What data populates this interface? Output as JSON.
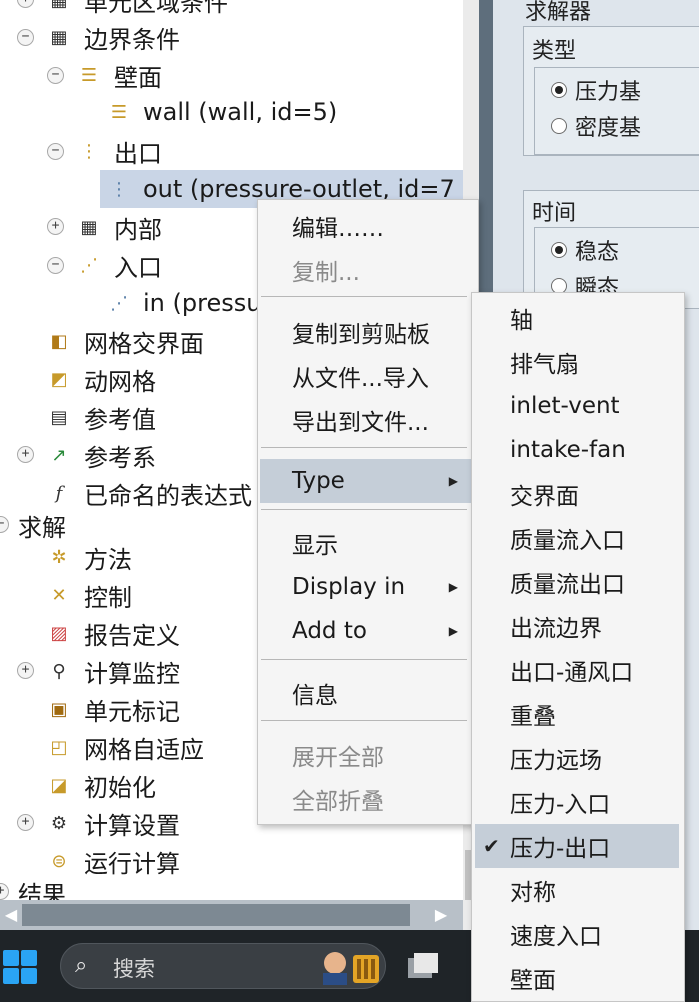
{
  "tree": {
    "items": [
      {
        "label": "单元区域条件",
        "expander": "+",
        "icon": "grid-icon"
      },
      {
        "label": "边界条件",
        "expander": "−",
        "icon": "grid-icon"
      },
      {
        "label": "壁面",
        "expander": "−",
        "icon": "wall-icon"
      },
      {
        "label": "wall (wall, id=5)",
        "expander": "",
        "icon": "wall-icon"
      },
      {
        "label": "出口",
        "expander": "−",
        "icon": "outlet-icon"
      },
      {
        "label": "out (pressure-outlet, id=7",
        "expander": "",
        "icon": "outlet-icon"
      },
      {
        "label": "内部",
        "expander": "+",
        "icon": "grid-icon"
      },
      {
        "label": "入口",
        "expander": "−",
        "icon": "inlet-icon"
      },
      {
        "label": "in (pressu",
        "expander": "",
        "icon": "inlet-icon"
      },
      {
        "label": "网格交界面",
        "expander": "",
        "icon": "mesh-interface-icon"
      },
      {
        "label": "动网格",
        "expander": "",
        "icon": "dynamic-mesh-icon"
      },
      {
        "label": "参考值",
        "expander": "",
        "icon": "clipboard-icon"
      },
      {
        "label": "参考系",
        "expander": "+",
        "icon": "axes-icon"
      },
      {
        "label": "已命名的表达式",
        "expander": "",
        "icon": "function-icon"
      },
      {
        "label": "求解",
        "expander": "",
        "icon": ""
      },
      {
        "label": "方法",
        "expander": "",
        "icon": "method-icon"
      },
      {
        "label": "控制",
        "expander": "",
        "icon": "control-icon"
      },
      {
        "label": "报告定义",
        "expander": "",
        "icon": "report-icon"
      },
      {
        "label": "计算监控",
        "expander": "+",
        "icon": "monitor-icon"
      },
      {
        "label": "单元标记",
        "expander": "",
        "icon": "cell-mark-icon"
      },
      {
        "label": "网格自适应",
        "expander": "",
        "icon": "adapt-icon"
      },
      {
        "label": "初始化",
        "expander": "",
        "icon": "init-icon"
      },
      {
        "label": "计算设置",
        "expander": "+",
        "icon": "gear-icon"
      },
      {
        "label": "运行计算",
        "expander": "",
        "icon": "run-icon"
      },
      {
        "label": "结果",
        "expander": "",
        "icon": ""
      }
    ]
  },
  "solver_panel": {
    "title": "求解器",
    "type_label": "类型",
    "type_options": [
      "压力基",
      "密度基"
    ],
    "type_selected": "压力基",
    "time_label": "时间",
    "time_options": [
      "稳态",
      "瞬态"
    ],
    "time_selected": "稳态"
  },
  "context_menu": {
    "items": [
      "编辑……",
      "复制...",
      "复制到剪贴板",
      "从文件...导入",
      "导出到文件...",
      "Type",
      "显示",
      "Display in",
      "Add to",
      "信息",
      "展开全部",
      "全部折叠"
    ],
    "disabled": [
      "复制...",
      "展开全部",
      "全部折叠"
    ],
    "highlighted": "Type"
  },
  "type_submenu": {
    "items": [
      "轴",
      "排气扇",
      "inlet-vent",
      "intake-fan",
      "交界面",
      "质量流入口",
      "质量流出口",
      "出流边界",
      "出口-通风口",
      "重叠",
      "压力远场",
      "压力-入口",
      "压力-出口",
      "对称",
      "速度入口",
      "壁面"
    ],
    "checked": "压力-出口"
  },
  "taskbar": {
    "search_placeholder": "搜索"
  },
  "colors": {
    "selection": "#c9d5e6",
    "menu_highlight": "#c5ced8",
    "taskbar": "#1f2428",
    "start_blue": "#2aa4f4"
  }
}
